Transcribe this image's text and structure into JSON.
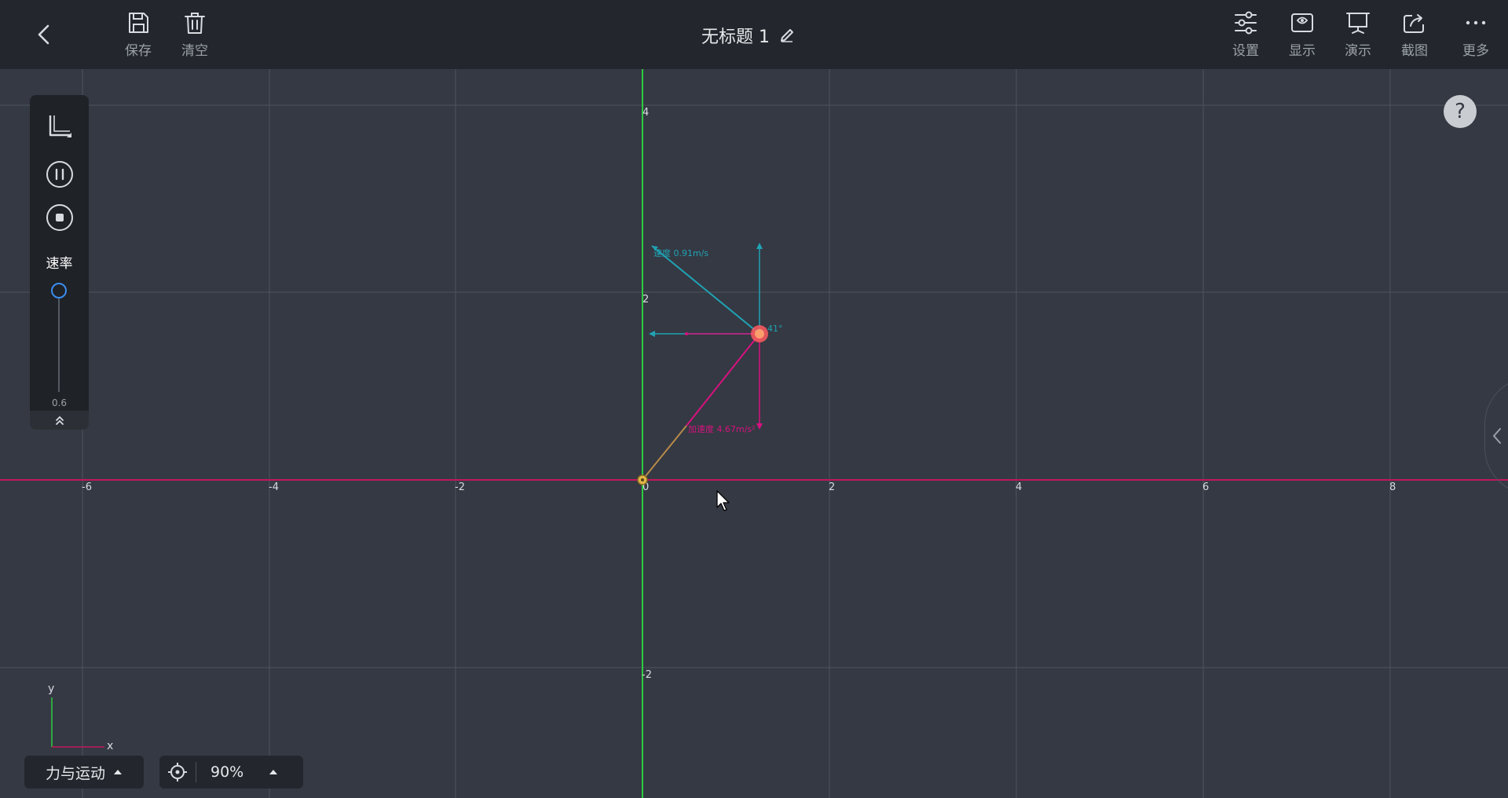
{
  "toolbar": {
    "save_label": "保存",
    "clear_label": "清空",
    "settings_label": "设置",
    "display_label": "显示",
    "present_label": "演示",
    "screenshot_label": "截图",
    "more_label": "更多"
  },
  "document": {
    "title": "无标题 1"
  },
  "controls": {
    "speed_label": "速率",
    "speed_value": "0.6",
    "speed_fraction": 0.0
  },
  "help": {
    "label": "?"
  },
  "axes": {
    "x_ticks": [
      "-6",
      "-4",
      "-2",
      "0",
      "2",
      "4",
      "6",
      "8"
    ],
    "y_ticks": [
      "4",
      "2",
      "-2"
    ],
    "origin_label": "0",
    "mini_x": "x",
    "mini_y": "y"
  },
  "annotations": {
    "velocity": "速度 0.91m/s",
    "angle": "41°",
    "acceleration": "加速度 4.67m/s²"
  },
  "bottom": {
    "mode_label": "力与运动",
    "zoom_value": "90%"
  },
  "colors": {
    "accent": "#3a8df0",
    "y_axis": "#2ecc40",
    "x_axis": "#c2185b",
    "velocity": "#1fa3b5",
    "acceleration": "#d6127f",
    "rope": "#b68a4a",
    "ball": "#ff5a5f"
  }
}
